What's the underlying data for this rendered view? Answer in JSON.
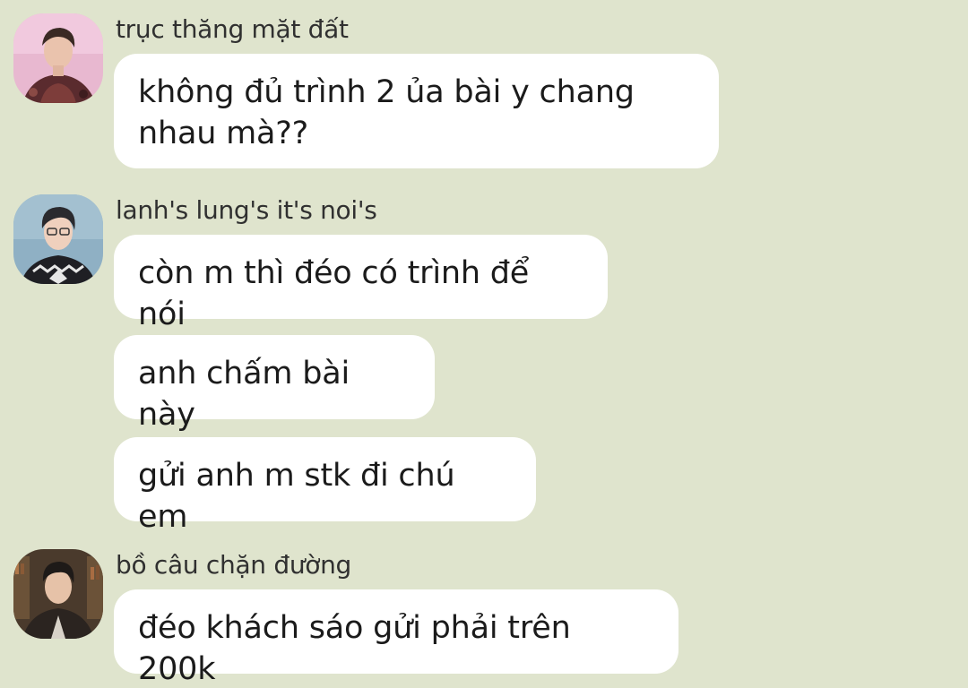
{
  "background_color": "#dfe4cd",
  "bubble_color": "#ffffff",
  "messages": [
    {
      "sender": "trục thăng mặt đất",
      "avatar_icon": "user-avatar-1",
      "bubbles": [
        "không đủ trình 2 ủa bài y chang nhau mà??"
      ]
    },
    {
      "sender": "lanh's lung's it's noi's",
      "avatar_icon": "user-avatar-2",
      "bubbles": [
        "còn m thì đéo có trình để nói",
        "anh chấm bài này",
        "gửi anh m stk đi chú em"
      ]
    },
    {
      "sender": "bồ câu chặn đường",
      "avatar_icon": "user-avatar-3",
      "bubbles": [
        "đéo khách sáo gửi phải trên 200k"
      ]
    }
  ]
}
